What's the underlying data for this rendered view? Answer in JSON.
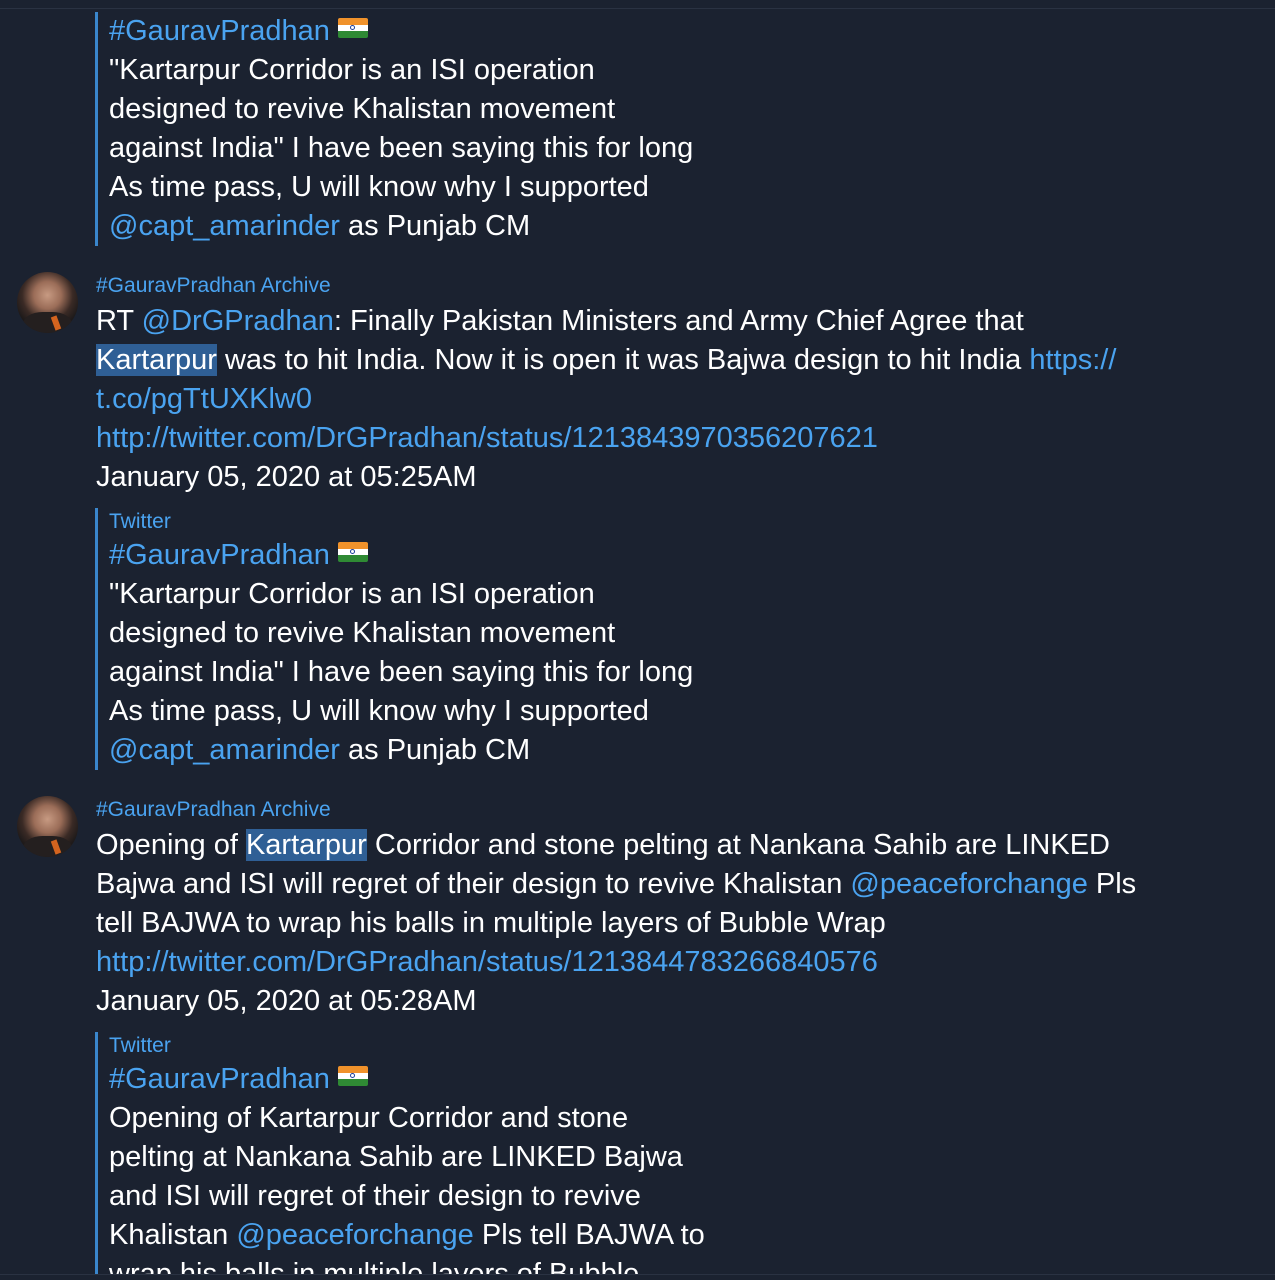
{
  "quote_top": {
    "title": "#GauravPradhan",
    "flag_icon": "india-flag-icon",
    "lines": [
      "\"Kartarpur Corridor is an ISI operation",
      "designed to revive Khalistan movement",
      "against India\" I have been saying this for long",
      "As time pass, U will know why I supported"
    ],
    "mention": "@capt_amarinder",
    "mention_rest": " as Punjab CM"
  },
  "messages": [
    {
      "sender": "#GauravPradhan Archive",
      "line1_prefix": "RT ",
      "line1_mention": "@DrGPradhan",
      "line1_rest": ": Finally Pakistan Ministers and Army Chief Agree that",
      "line2_highlight": "Kartarpur",
      "line2_rest": " was to hit India. Now it is open it was Bajwa design to hit India ",
      "line2_link": "https://",
      "line3_link": "t.co/pgTtUXKlw0",
      "url": "http://twitter.com/DrGPradhan/status/1213843970356207621",
      "timestamp": "January 05, 2020 at 05:25AM",
      "preview": {
        "source": "Twitter",
        "title": "#GauravPradhan",
        "lines": [
          "\"Kartarpur Corridor is an ISI operation",
          "designed to revive Khalistan movement",
          "against India\" I have been saying this for long",
          "As time pass, U will know why I supported"
        ],
        "mention": "@capt_amarinder",
        "mention_rest": " as Punjab CM"
      }
    },
    {
      "sender": "#GauravPradhan Archive",
      "line1_prefix": "Opening of ",
      "line1_highlight": "Kartarpur",
      "line1_rest": " Corridor and stone pelting at Nankana Sahib are LINKED",
      "line2_text": "Bajwa and ISI will regret of their design to revive Khalistan ",
      "line2_mention": "@peaceforchange",
      "line2_rest": " Pls",
      "line3_text": "tell BAJWA to wrap his balls in multiple layers of Bubble Wrap",
      "url": "http://twitter.com/DrGPradhan/status/1213844783266840576",
      "timestamp": "January 05, 2020 at 05:28AM",
      "preview": {
        "source": "Twitter",
        "title": "#GauravPradhan",
        "lines": [
          "Opening of Kartarpur Corridor and stone",
          "pelting at Nankana Sahib are LINKED Bajwa",
          "and ISI will regret of their design to revive"
        ],
        "line4_prefix": "Khalistan ",
        "line4_mention": "@peaceforchange",
        "line4_rest": " Pls tell BAJWA to",
        "line5_partial": "wrap his balls in multiple layers of Bubble"
      }
    }
  ]
}
